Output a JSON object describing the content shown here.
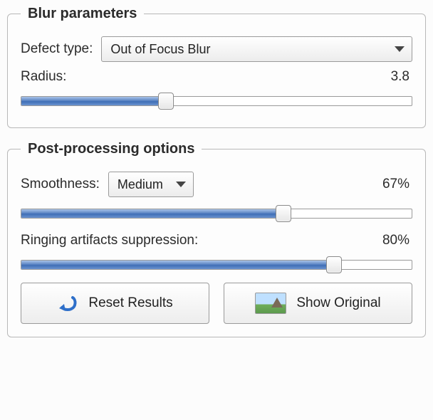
{
  "blur_params": {
    "legend": "Blur parameters",
    "defect_type_label": "Defect type:",
    "defect_type_value": "Out of Focus Blur",
    "radius_label": "Radius:",
    "radius_value": "3.8",
    "radius_percent": 37
  },
  "post_processing": {
    "legend": "Post-processing options",
    "smoothness_label": "Smoothness:",
    "smoothness_value": "Medium",
    "smoothness_percent_text": "67%",
    "smoothness_percent": 67,
    "ringing_label": "Ringing artifacts suppression:",
    "ringing_percent_text": "80%",
    "ringing_percent": 80,
    "reset_label": "Reset Results",
    "show_original_label": "Show Original"
  }
}
